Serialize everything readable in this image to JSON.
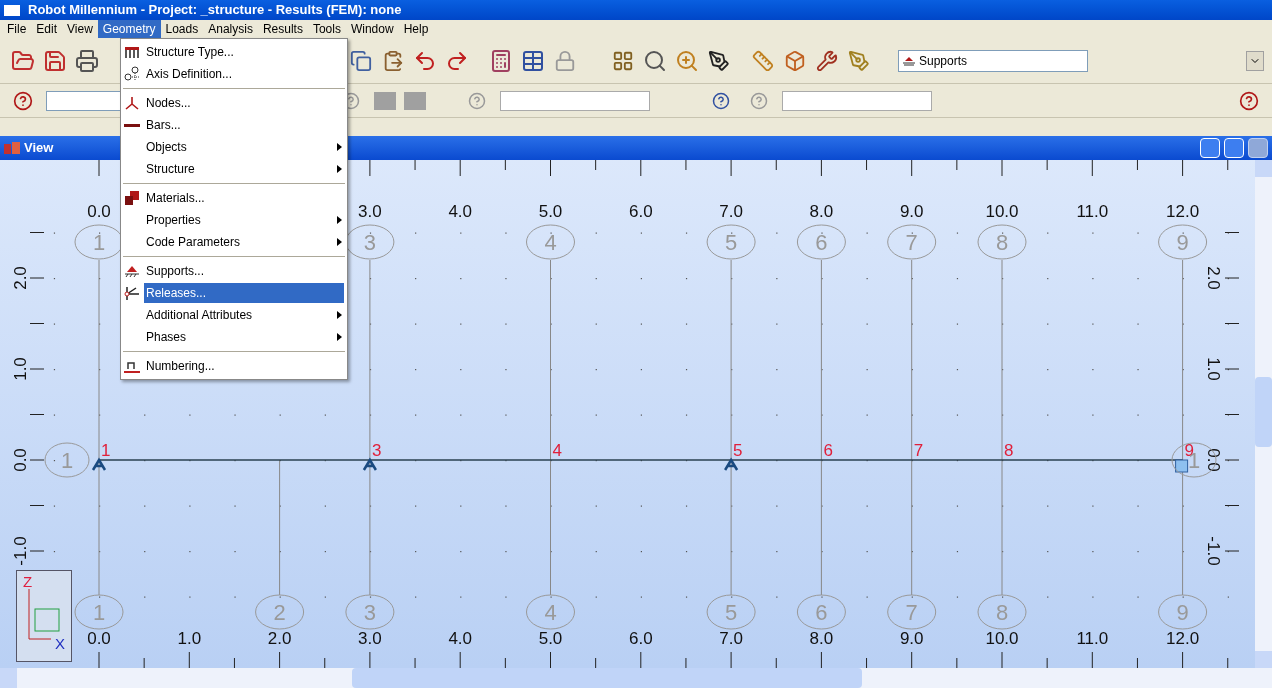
{
  "window": {
    "title": "Robot Millennium - Project: _structure - Results (FEM): none"
  },
  "menu_bar": [
    {
      "label": "File",
      "selected": false
    },
    {
      "label": "Edit",
      "selected": false
    },
    {
      "label": "View",
      "selected": false
    },
    {
      "label": "Geometry",
      "selected": true
    },
    {
      "label": "Loads",
      "selected": false
    },
    {
      "label": "Analysis",
      "selected": false
    },
    {
      "label": "Results",
      "selected": false
    },
    {
      "label": "Tools",
      "selected": false
    },
    {
      "label": "Window",
      "selected": false
    },
    {
      "label": "Help",
      "selected": false
    }
  ],
  "geometry_menu": [
    {
      "kind": "item",
      "label": "Structure Type...",
      "selected": false
    },
    {
      "kind": "item",
      "label": "Axis Definition...",
      "selected": false
    },
    {
      "kind": "separator"
    },
    {
      "kind": "item",
      "label": "Nodes...",
      "selected": false
    },
    {
      "kind": "item",
      "label": "Bars...",
      "selected": false
    },
    {
      "kind": "submenu",
      "label": "Objects",
      "selected": false
    },
    {
      "kind": "submenu",
      "label": "Structure",
      "selected": false
    },
    {
      "kind": "separator"
    },
    {
      "kind": "item",
      "label": "Materials...",
      "selected": false
    },
    {
      "kind": "submenu",
      "label": "Properties",
      "selected": false
    },
    {
      "kind": "submenu",
      "label": "Code Parameters",
      "selected": false
    },
    {
      "kind": "separator"
    },
    {
      "kind": "item",
      "label": "Supports...",
      "selected": false
    },
    {
      "kind": "item",
      "label": "Releases...",
      "selected": true
    },
    {
      "kind": "submenu",
      "label": "Additional Attributes",
      "selected": false
    },
    {
      "kind": "submenu",
      "label": "Phases",
      "selected": false
    },
    {
      "kind": "separator"
    },
    {
      "kind": "item",
      "label": "Numbering...",
      "selected": false
    }
  ],
  "toolbar": {
    "layer_dropdown": "Supports"
  },
  "view": {
    "title": "View",
    "top_ruler": [
      "0.0",
      "3.0",
      "4.0",
      "5.0",
      "6.0",
      "7.0",
      "8.0",
      "9.0",
      "10.0",
      "11.0",
      "12.0"
    ],
    "bottom_ruler": [
      "0.0",
      "1.0",
      "2.0",
      "3.0",
      "4.0",
      "5.0",
      "6.0",
      "7.0",
      "8.0",
      "9.0",
      "10.0",
      "11.0",
      "12.0"
    ],
    "left_ruler": [
      "2.0",
      "1.0",
      "0.0",
      "-1.0"
    ],
    "right_ruler": [
      "2.0",
      "1.0",
      "0.0",
      "-1.0"
    ],
    "row_bubbles": [
      "1",
      "1"
    ],
    "grid_lines": [
      {
        "top_bubble": "1",
        "bottom_bubble": "1",
        "node": "1",
        "kind": "pinned"
      },
      {
        "bottom_bubble": "2",
        "kind": "free"
      },
      {
        "top_bubble": "3",
        "bottom_bubble": "3",
        "node": "3",
        "kind": "pinned"
      },
      {
        "top_bubble": "4",
        "bottom_bubble": "4",
        "node": "4",
        "kind": "free"
      },
      {
        "top_bubble": "5",
        "bottom_bubble": "5",
        "node": "5",
        "kind": "pinned"
      },
      {
        "top_bubble": "6",
        "bottom_bubble": "6",
        "node": "6",
        "kind": "free"
      },
      {
        "top_bubble": "7",
        "bottom_bubble": "7",
        "node": "7",
        "kind": "free"
      },
      {
        "top_bubble": "8",
        "bottom_bubble": "8",
        "node": "8",
        "kind": "free"
      },
      {
        "top_bubble": "9",
        "bottom_bubble": "9",
        "node": "9",
        "kind": "fixed"
      }
    ],
    "axis_gizmo": {
      "z": "Z",
      "x": "X"
    }
  }
}
